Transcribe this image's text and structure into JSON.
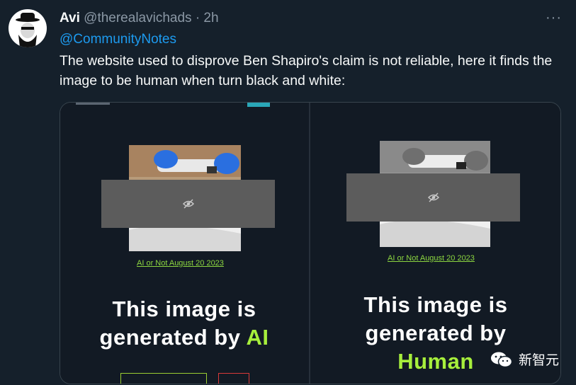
{
  "tweet": {
    "author_name": "Avi",
    "author_handle": "@therealavichads",
    "separator": "·",
    "time": "2h",
    "more": "···",
    "mention": "@CommunityNotes",
    "text": "The website used to disprove Ben Shapiro's claim is not reliable, here it finds the image to be human when turn black and white:"
  },
  "media": {
    "left": {
      "caption": "AI or Not August 20 2023",
      "verdict_line1": "This image is",
      "verdict_line2": "generated by",
      "verdict_highlight": "AI"
    },
    "right": {
      "caption": "AI or Not August 20 2023",
      "verdict_line1": "This image is",
      "verdict_line2": "generated by",
      "verdict_highlight": "Human"
    }
  },
  "watermark": {
    "label": "新智元"
  },
  "colors": {
    "background": "#15202b",
    "link": "#1d9bf0",
    "highlight": "#a7ef3c",
    "caption": "#8cd640"
  }
}
